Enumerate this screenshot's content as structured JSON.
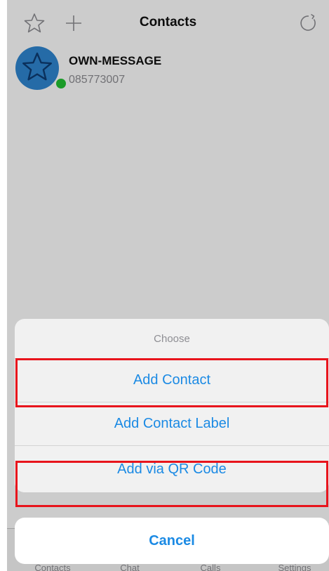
{
  "navbar": {
    "title": "Contacts",
    "left_icons": [
      "star-outline-icon",
      "plus-icon"
    ],
    "right_icon": "refresh-icon"
  },
  "contact": {
    "name": "OWN-MESSAGE",
    "number": "085773007",
    "avatar_icon": "star-icon",
    "status": "online",
    "avatar_color": "#2f86d1",
    "status_color": "#22c232"
  },
  "tabbar": {
    "items": [
      "Contacts",
      "Chat",
      "Calls",
      "Settings"
    ]
  },
  "action_sheet": {
    "title": "Choose",
    "options": [
      "Add Contact",
      "Add Contact Label",
      "Add via QR Code"
    ],
    "cancel": "Cancel",
    "accent_color": "#1b8ae4",
    "highlighted_options": [
      "Add Contact",
      "Add via QR Code"
    ],
    "highlight_color": "#e8141c"
  }
}
